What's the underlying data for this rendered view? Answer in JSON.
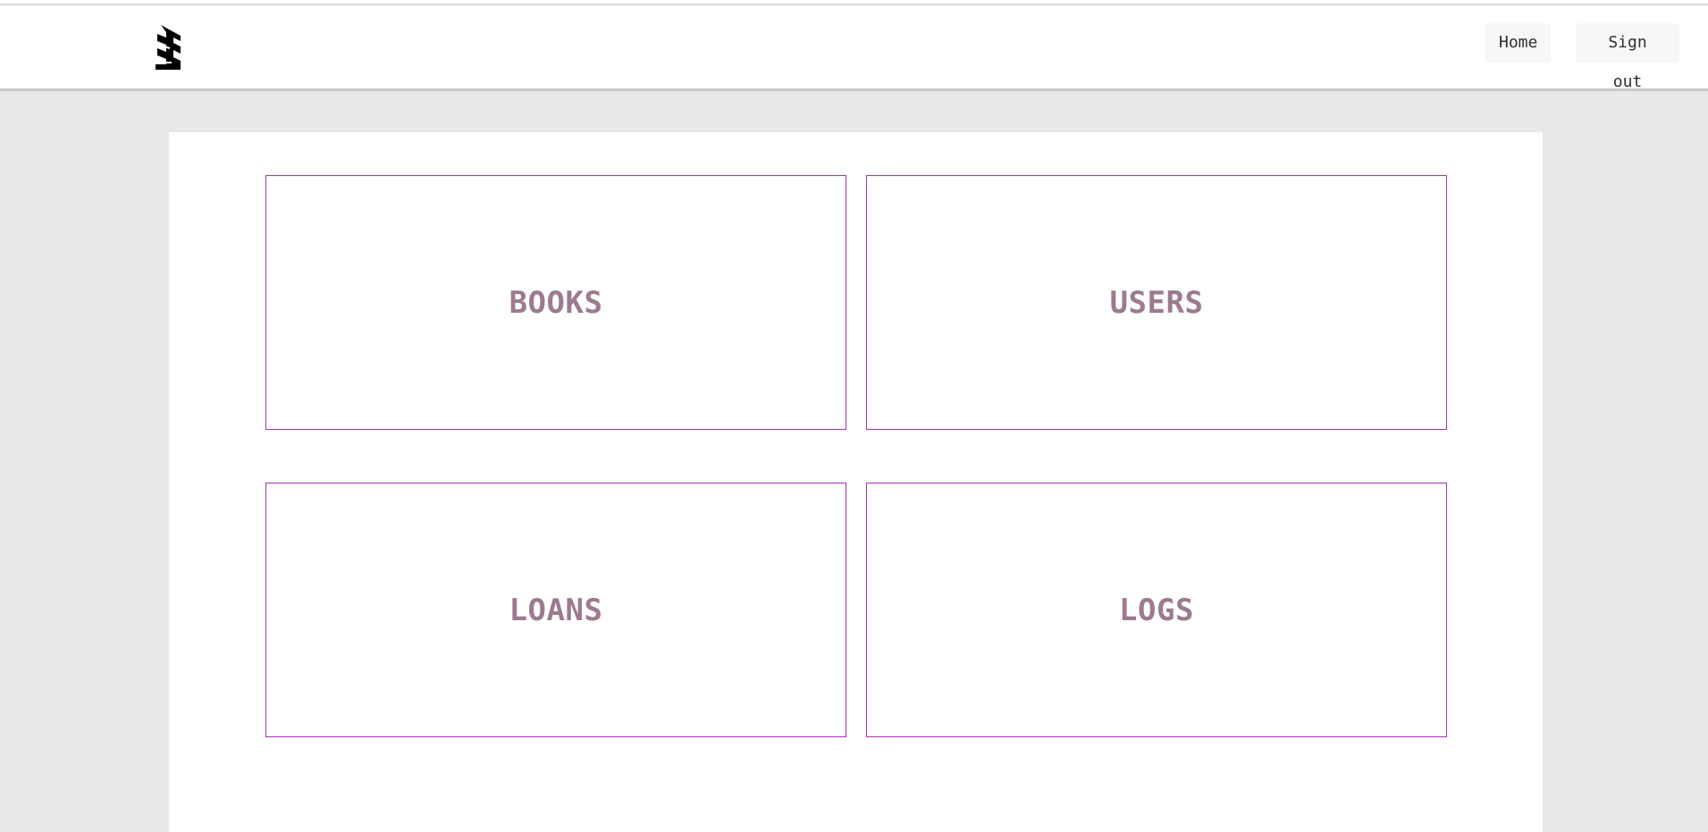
{
  "header": {
    "logo_icon": "building-logo-icon",
    "nav": {
      "home_label": "Home",
      "signout_label": "Sign out"
    }
  },
  "dashboard": {
    "cards": [
      {
        "label": "BOOKS"
      },
      {
        "label": "USERS"
      },
      {
        "label": "LOANS"
      },
      {
        "label": "LOGS"
      }
    ]
  },
  "colors": {
    "card_border": "#a332a8",
    "card_label": "#9c7a8f",
    "page_background": "#e8e8e8",
    "nav_button_background": "#f6f7f8"
  }
}
